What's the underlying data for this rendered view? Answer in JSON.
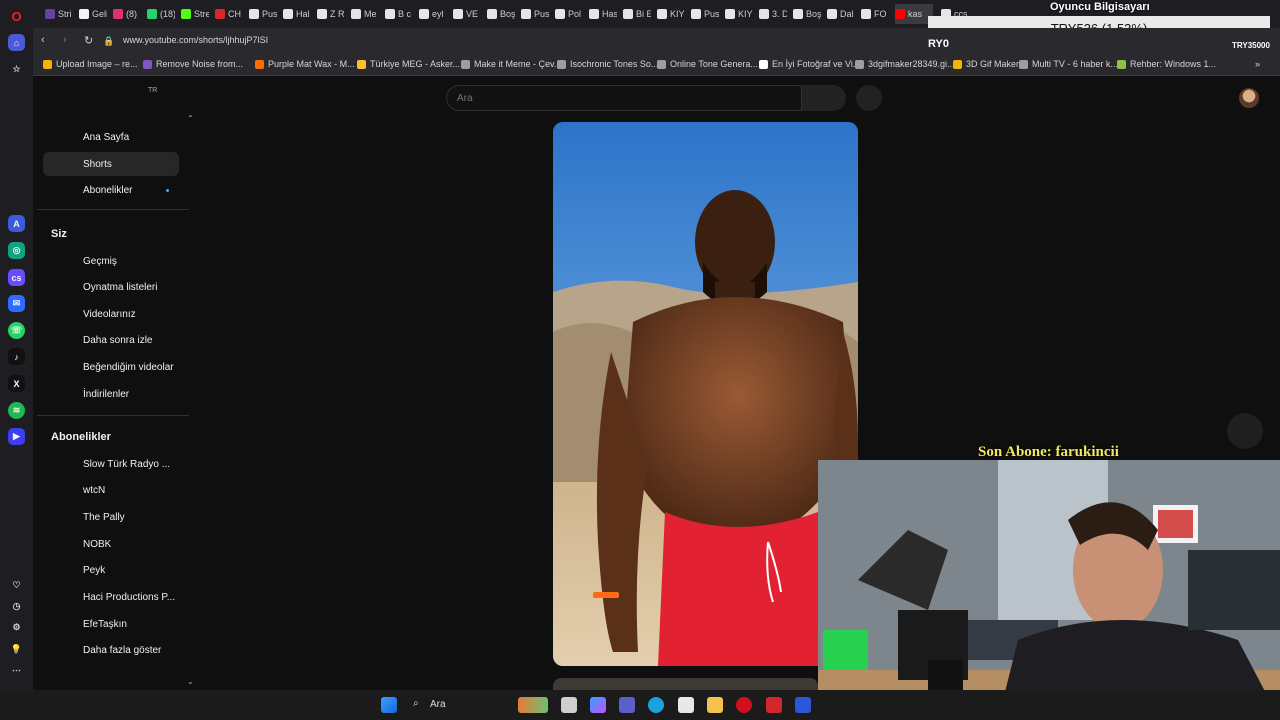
{
  "tabs": [
    {
      "label": "Stri",
      "color": "#6441a5"
    },
    {
      "label": "Geli",
      "color": "#f4f4f4"
    },
    {
      "label": "(8)",
      "color": "#e1306c"
    },
    {
      "label": "(18)",
      "color": "#25d366"
    },
    {
      "label": "Stre",
      "color": "#53fc18"
    },
    {
      "label": "CH",
      "color": "#d62828"
    },
    {
      "label": "Pus",
      "color": "#e5e5e5"
    },
    {
      "label": "Hal",
      "color": "#e5e5e5"
    },
    {
      "label": "Z R",
      "color": "#e5e5e5"
    },
    {
      "label": "Me",
      "color": "#e5e5e5"
    },
    {
      "label": "B c",
      "color": "#e5e5e5"
    },
    {
      "label": "eyl",
      "color": "#e5e5e5"
    },
    {
      "label": "VE",
      "color": "#e5e5e5"
    },
    {
      "label": "Boş",
      "color": "#e5e5e5"
    },
    {
      "label": "Pus",
      "color": "#e5e5e5"
    },
    {
      "label": "Pol",
      "color": "#e5e5e5"
    },
    {
      "label": "Has",
      "color": "#e5e5e5"
    },
    {
      "label": "Bi E",
      "color": "#e5e5e5"
    },
    {
      "label": "KIY",
      "color": "#e5e5e5"
    },
    {
      "label": "Pus",
      "color": "#e5e5e5"
    },
    {
      "label": "KIY",
      "color": "#e5e5e5"
    },
    {
      "label": "3. D",
      "color": "#e5e5e5"
    },
    {
      "label": "Boş",
      "color": "#e5e5e5"
    },
    {
      "label": "Dal",
      "color": "#e5e5e5"
    },
    {
      "label": "FO",
      "color": "#e5e5e5"
    },
    {
      "label": "kas",
      "color": "#ff0000"
    },
    {
      "label": "ccs",
      "color": "#e5e5e5"
    }
  ],
  "address": {
    "url": "www.youtube.com/shorts/ljhhujP7lSI"
  },
  "bookmarks": [
    {
      "label": "Upload Image – re...",
      "color": "#f4b400"
    },
    {
      "label": "Remove Noise from...",
      "color": "#7e57c2"
    },
    {
      "label": "Purple Mat Wax - M...",
      "color": "#ff6f00"
    },
    {
      "label": "Türkiye MEG - Asker...",
      "color": "#fbc02d"
    },
    {
      "label": "Make it Meme - Çev...",
      "color": "#9e9e9e"
    },
    {
      "label": "Isochronic Tones So...",
      "color": "#9e9e9e"
    },
    {
      "label": "Online Tone Genera...",
      "color": "#9e9e9e"
    },
    {
      "label": "En İyi Fotoğraf ve Vi...",
      "color": "#ffffff"
    },
    {
      "label": "3dgifmaker28349.gi...",
      "color": "#9e9e9e"
    },
    {
      "label": "3D Gif Maker",
      "color": "#f4b400"
    },
    {
      "label": "Multi TV - 6 haber k...",
      "color": "#9e9e9e"
    },
    {
      "label": "Rehber: Windows 1...",
      "color": "#8bc34a"
    }
  ],
  "sidebar": {
    "lang": "TR",
    "main": [
      "Ana Sayfa",
      "Shorts",
      "Abonelikler"
    ],
    "you_heading": "Siz",
    "you": [
      "Geçmiş",
      "Oynatma listeleri",
      "Videolarınız",
      "Daha sonra izle",
      "Beğendiğim videolar",
      "İndirilenler"
    ],
    "subs_heading": "Abonelikler",
    "subs": [
      "Slow Türk Radyo ...",
      "wtcN",
      "The Pally",
      "NOBK",
      "Peyk",
      "Haci Productions P...",
      "EfeTaşkın",
      "Daha fazla göster"
    ]
  },
  "search": {
    "placeholder": "Ara"
  },
  "overlay": {
    "donation": "TRY536 (1.53%)",
    "player_info": "Oyuncu Bilgisayarı",
    "goal_left": "RY0",
    "goal_right": "TRY35000",
    "last_sub": "Son Abone: farukincii"
  },
  "taskbar": {
    "search_label": "Ara"
  },
  "colors": {
    "yt_bg": "#0f0f0f",
    "yt_active": "#272727",
    "last_sub_color": "#f2e85a"
  }
}
